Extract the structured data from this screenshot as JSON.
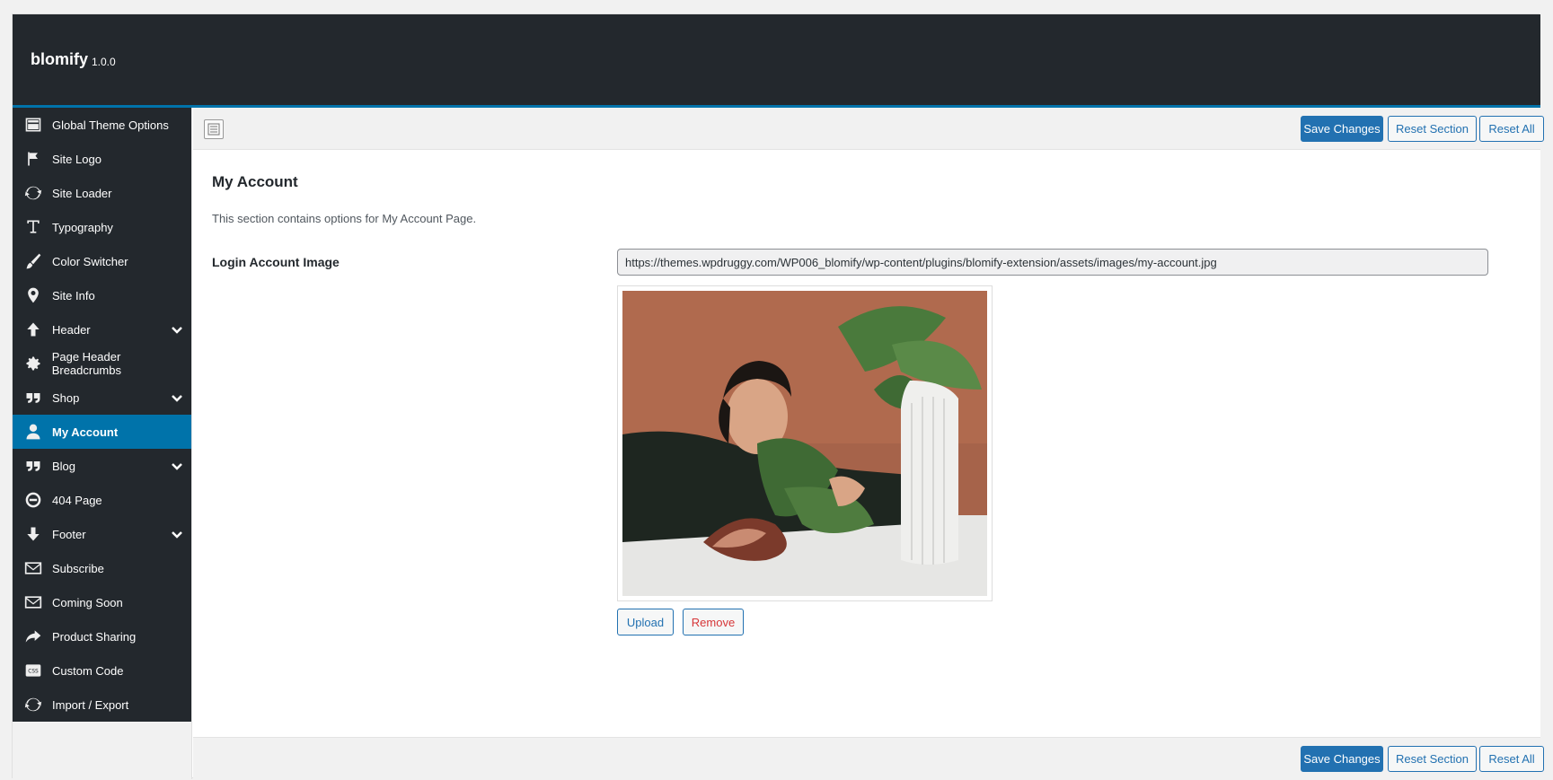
{
  "header": {
    "brand": "blomify",
    "version": "1.0.0"
  },
  "sidebar": {
    "items": [
      {
        "label": "Global Theme Options",
        "icon": "layout-icon",
        "name": "global-theme-options",
        "expandable": false,
        "active": false
      },
      {
        "label": "Site Logo",
        "icon": "flag-icon",
        "name": "site-logo",
        "expandable": false,
        "active": false
      },
      {
        "label": "Site Loader",
        "icon": "refresh-icon",
        "name": "site-loader",
        "expandable": false,
        "active": false
      },
      {
        "label": "Typography",
        "icon": "text-icon",
        "name": "typography",
        "expandable": false,
        "active": false
      },
      {
        "label": "Color Switcher",
        "icon": "brush-icon",
        "name": "color-switcher",
        "expandable": false,
        "active": false
      },
      {
        "label": "Site Info",
        "icon": "map-pin-icon",
        "name": "site-info",
        "expandable": false,
        "active": false
      },
      {
        "label": "Header",
        "icon": "arrow-up-icon",
        "name": "header",
        "expandable": true,
        "active": false
      },
      {
        "label": "Page Header Breadcrumbs",
        "icon": "gear-icon",
        "name": "page-header-breadcrumbs",
        "expandable": false,
        "active": false
      },
      {
        "label": "Shop",
        "icon": "quote-icon",
        "name": "shop",
        "expandable": true,
        "active": false
      },
      {
        "label": "My Account",
        "icon": "user-icon",
        "name": "my-account",
        "expandable": false,
        "active": true
      },
      {
        "label": "Blog",
        "icon": "quote-icon",
        "name": "blog",
        "expandable": true,
        "active": false
      },
      {
        "label": "404 Page",
        "icon": "minus-circle-icon",
        "name": "404-page",
        "expandable": false,
        "active": false
      },
      {
        "label": "Footer",
        "icon": "arrow-down-icon",
        "name": "footer",
        "expandable": true,
        "active": false
      },
      {
        "label": "Subscribe",
        "icon": "envelope-icon",
        "name": "subscribe",
        "expandable": false,
        "active": false
      },
      {
        "label": "Coming Soon",
        "icon": "envelope-icon",
        "name": "coming-soon",
        "expandable": false,
        "active": false
      },
      {
        "label": "Product Sharing",
        "icon": "share-icon",
        "name": "product-sharing",
        "expandable": false,
        "active": false
      },
      {
        "label": "Custom Code",
        "icon": "css-icon",
        "name": "custom-code",
        "expandable": false,
        "active": false
      },
      {
        "label": "Import / Export",
        "icon": "refresh-icon",
        "name": "import-export",
        "expandable": false,
        "active": false
      }
    ]
  },
  "toolbar": {
    "save_label": "Save Changes",
    "reset_section_label": "Reset Section",
    "reset_all_label": "Reset All"
  },
  "section": {
    "title": "My Account",
    "description": "This section contains options for My Account Page."
  },
  "field": {
    "label": "Login Account Image",
    "value": "https://themes.wpdruggy.com/WP006_blomify/wp-content/plugins/blomify-extension/assets/images/my-account.jpg",
    "upload_label": "Upload",
    "remove_label": "Remove"
  },
  "colors": {
    "header_bg": "#23282d",
    "accent": "#0073aa",
    "button_primary": "#2271b1",
    "remove_text": "#d63638"
  }
}
